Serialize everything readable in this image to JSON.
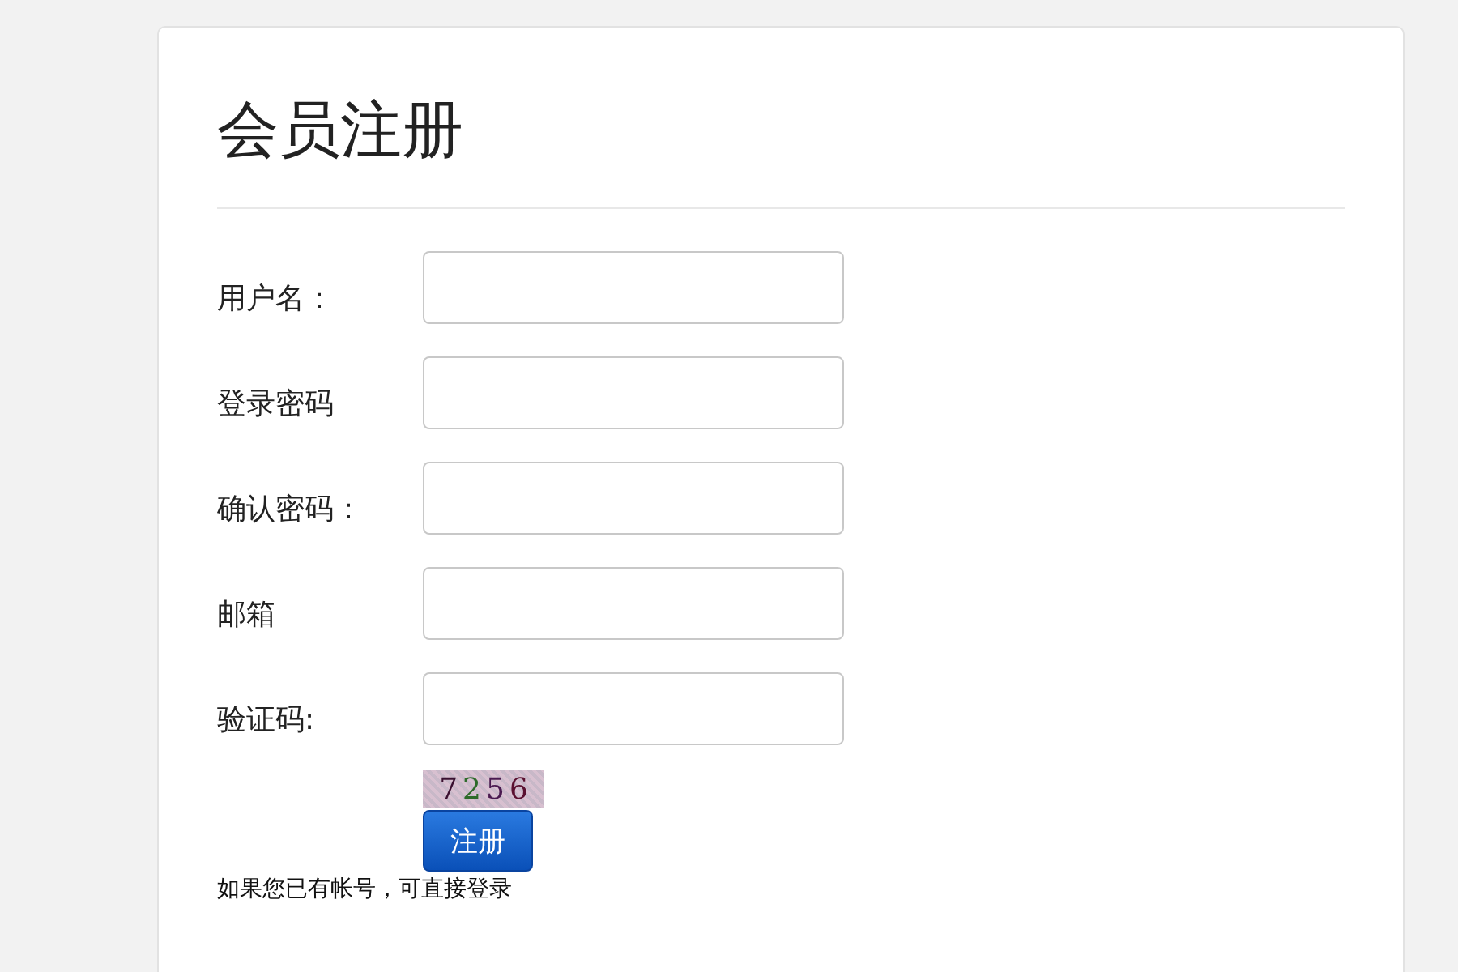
{
  "title": "会员注册",
  "fields": [
    {
      "label": "用户名："
    },
    {
      "label": "登录密码"
    },
    {
      "label": "确认密码："
    },
    {
      "label": "邮箱"
    },
    {
      "label": "验证码:"
    }
  ],
  "captcha": "7256",
  "submit_button": "注册",
  "login_hint": "如果您已有帐号，可直接登录"
}
